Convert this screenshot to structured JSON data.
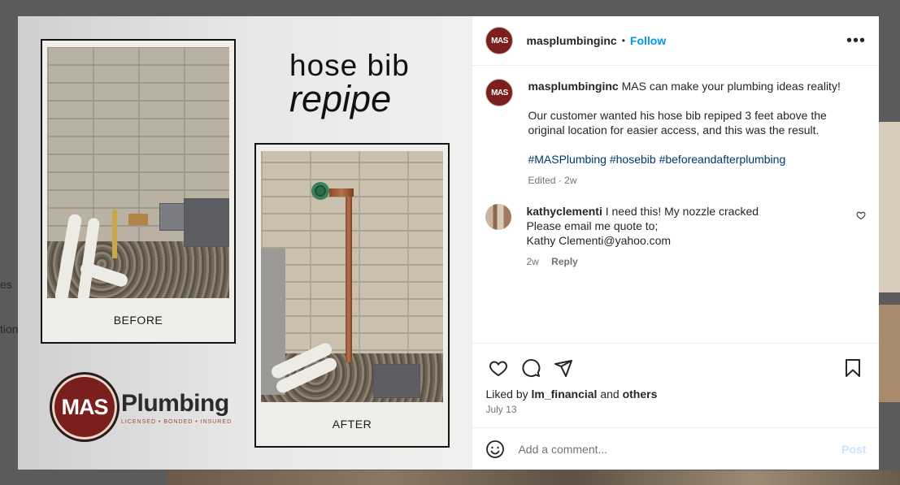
{
  "background": {
    "side_texts": [
      "es",
      "tion"
    ]
  },
  "media": {
    "title_line1": "hose bib",
    "title_line2": "repipe",
    "before_caption": "BEFORE",
    "after_caption": "AFTER",
    "logo_initials": "MAS",
    "logo_word": "Plumbing",
    "logo_tagline": "LICENSED • BONDED • INSURED"
  },
  "header": {
    "avatar_text": "MAS",
    "username": "masplumbinginc",
    "separator": "•",
    "follow_label": "Follow",
    "more_label": "•••"
  },
  "caption": {
    "avatar_text": "MAS",
    "username": "masplumbinginc",
    "text_intro": "MAS can make your plumbing ideas reality!",
    "text_body": "Our customer wanted his hose bib repiped 3 feet above the original location for easier access, and this was the result.",
    "hashtags": "#MASPlumbing #hosebib #beforeandafterplumbing",
    "meta": "Edited · 2w"
  },
  "comment": {
    "username": "kathyclementi",
    "line1": "I need this! My nozzle cracked",
    "line2": "Please email me quote to;",
    "line3": "Kathy Clementi@yahoo.com",
    "time": "2w",
    "reply_label": "Reply"
  },
  "actions": {
    "liked_prefix": "Liked by",
    "liked_user": "lm_financial",
    "liked_and": "and",
    "liked_others": "others",
    "date": "July 13"
  },
  "add_comment": {
    "placeholder": "Add a comment...",
    "post_label": "Post"
  }
}
